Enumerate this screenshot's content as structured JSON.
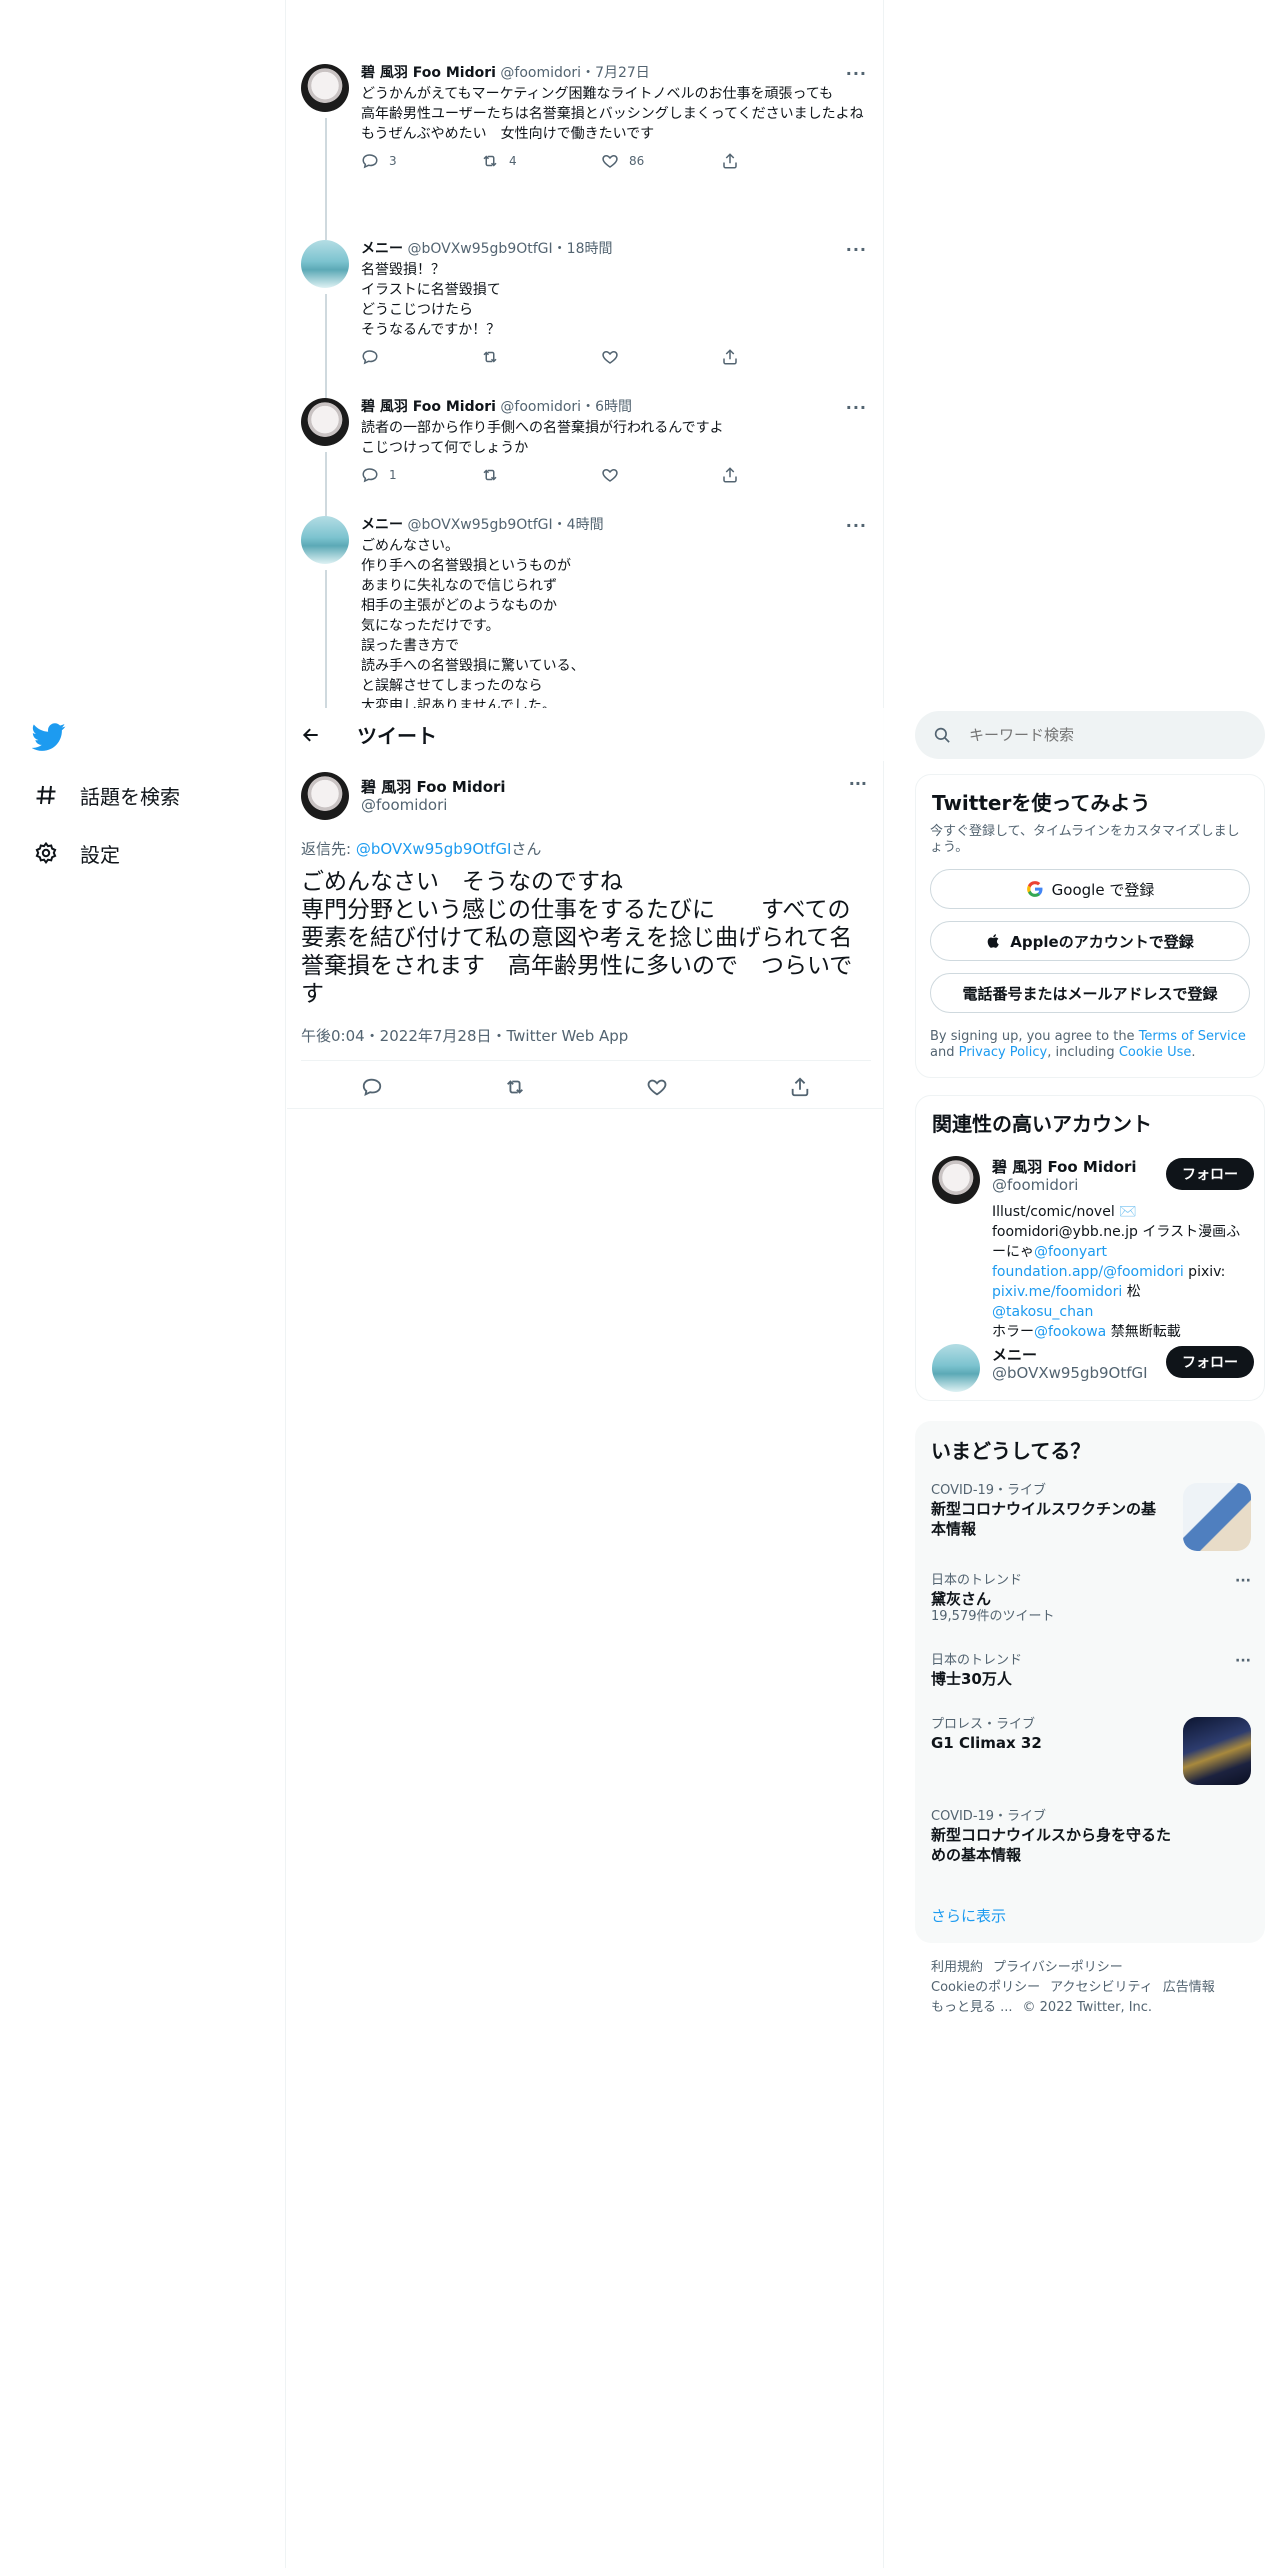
{
  "nav": {
    "items": [
      {
        "label": "話題を検索",
        "icon": "hashtag-icon"
      },
      {
        "label": "設定",
        "icon": "gear-icon"
      }
    ]
  },
  "thread": [
    {
      "name": "碧 風羽 Foo Midori",
      "handle": "@foomidori",
      "time": "7月27日",
      "text": "どうかんがえてもマーケティング困難なライトノベルのお仕事を頑張っても\n高年齢男性ユーザーたちは名誉棄損とバッシングしまくってくださいましたよね\nもうぜんぶやめたい　女性向けで働きたいです",
      "reply": "3",
      "retweet": "4",
      "like": "86"
    },
    {
      "name": "メニー",
      "handle": "@bOVXw95gb9OtfGI",
      "time": "18時間",
      "text": "名誉毀損！？\nイラストに名誉毀損て\nどうこじつけたら\nそうなるんですか！？",
      "reply": "",
      "retweet": "",
      "like": ""
    },
    {
      "name": "碧 風羽 Foo Midori",
      "handle": "@foomidori",
      "time": "6時間",
      "text": "読者の一部から作り手側への名誉棄損が行われるんですよ\nこじつけって何でしょうか",
      "reply": "1",
      "retweet": "",
      "like": ""
    },
    {
      "name": "メニー",
      "handle": "@bOVXw95gb9OtfGI",
      "time": "4時間",
      "text": "ごめんなさい。\n作り手への名誉毀損というものが\nあまりに失礼なので信じられず\n相手の主張がどのようなものか\n気になっただけです。\n誤った書き方で\n読み手への名誉毀損に驚いている、\nと誤解させてしまったのなら\n大変申し訳ありませんでした。",
      "reply": "",
      "retweet": "",
      "like": ""
    }
  ],
  "header": {
    "title": "ツイート"
  },
  "main_tweet": {
    "name": "碧 風羽 Foo Midori",
    "handle": "@foomidori",
    "reply_prefix": "返信先: ",
    "reply_handle": "@bOVXw95gb9OtfGI",
    "reply_suffix": "さん",
    "text": "ごめんなさい　そうなのですね\n専門分野という感じの仕事をするたびに　　すべての要素を結び付けて私の意図や考えを捻じ曲げられて名誉棄損をされます　高年齢男性に多いので　つらいです",
    "meta": "午後0:04・2022年7月28日・Twitter Web App"
  },
  "search": {
    "placeholder": "キーワード検索"
  },
  "signup": {
    "title": "Twitterを使ってみよう",
    "subtitle": "今すぐ登録して、タイムラインをカスタマイズしましょう。",
    "google": "Google で登録",
    "apple": "Appleのアカウントで登録",
    "phone": "電話番号またはメールアドレスで登録",
    "terms_pre": "By signing up, you agree to the ",
    "terms_link": "Terms of Service",
    "terms_mid": " and ",
    "privacy_link": "Privacy Policy",
    "terms_mid2": ", including ",
    "cookie_link": "Cookie Use",
    "terms_end": "."
  },
  "related": {
    "title": "関連性の高いアカウント",
    "follow_label": "フォロー",
    "accounts": [
      {
        "name": "碧 風羽 Foo Midori",
        "handle": "@foomidori",
        "bio_1": "Illust/comic/novel ✉️ foomidori@ybb.ne.jp イラスト漫画ふーにゃ",
        "bio_link1": "@foonyart",
        "bio_link2": "foundation.app/@foomidori",
        "bio_2": " pixiv: ",
        "bio_link3": "pixiv.me/foomidori",
        "bio_3": " 松",
        "bio_link4": "@takosu_chan",
        "bio_4": " ホラー",
        "bio_link5": "@fookowa",
        "bio_5": " 禁無断転載"
      },
      {
        "name": "メニー",
        "handle": "@bOVXw95gb9OtfGI"
      }
    ]
  },
  "trends": {
    "title": "いまどうしてる？",
    "items": [
      {
        "context": "COVID-19・ライブ",
        "title": "新型コロナウイルスワクチンの基本情報",
        "count": ""
      },
      {
        "context": "日本のトレンド",
        "title": "黛灰さん",
        "count": "19,579件のツイート"
      },
      {
        "context": "日本のトレンド",
        "title": "博士30万人",
        "count": ""
      },
      {
        "context": "プロレス・ライブ",
        "title": "G1 Climax 32",
        "count": ""
      },
      {
        "context": "COVID-19・ライブ",
        "title": "新型コロナウイルスから身を守るための基本情報",
        "count": ""
      }
    ],
    "show_more": "さらに表示"
  },
  "footer": {
    "links": [
      "利用規約",
      "プライバシーポリシー",
      "Cookieのポリシー",
      "アクセシビリティ",
      "広告情報",
      "もっと見る ..."
    ],
    "copyright": "© 2022 Twitter, Inc."
  },
  "colors": {
    "accent": "#1d9bf0",
    "text": "#0f1419",
    "muted": "#536471",
    "border": "#eff3f4"
  }
}
